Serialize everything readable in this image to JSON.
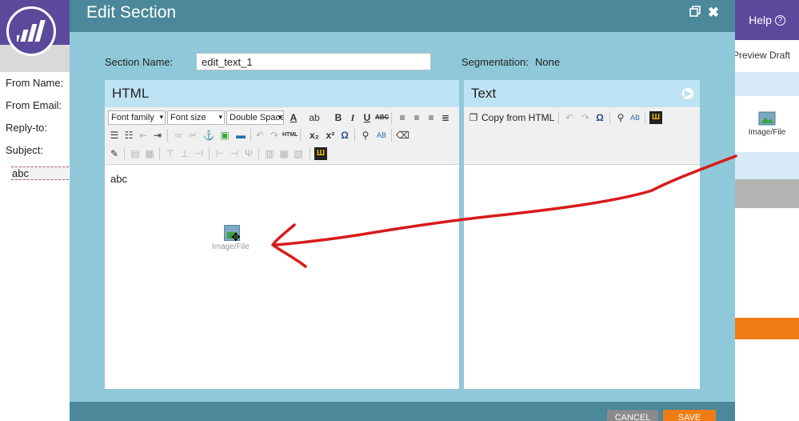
{
  "app": {
    "help_label": "Help",
    "help_icon": "?",
    "preview_draft": "Preview Draft",
    "fields": [
      "From Name:",
      "From Email:",
      "Reply-to:",
      "Subject:"
    ],
    "subject_value": "abc",
    "image_file_label": "Image/File"
  },
  "modal": {
    "title": "Edit Section",
    "section_name_label": "Section Name:",
    "section_name_value": "edit_text_1",
    "segmentation_label": "Segmentation:",
    "segmentation_value": "None",
    "cancel_label": "CANCEL",
    "save_label": "SAVE"
  },
  "html_panel": {
    "title": "HTML",
    "font_family": "Font family",
    "font_size": "Font size",
    "spacing": "Double Space",
    "content": "abc",
    "dragged_label": "Image/File"
  },
  "text_panel": {
    "title": "Text",
    "copy_label": "Copy from HTML"
  },
  "colors": {
    "brand_purple": "#5b4a9c",
    "modal_header": "#4b8899",
    "modal_body": "#8fc9d9",
    "panel_header": "#bee3f4",
    "accent_orange": "#f07c16",
    "annotation_red": "#d81b1b"
  }
}
